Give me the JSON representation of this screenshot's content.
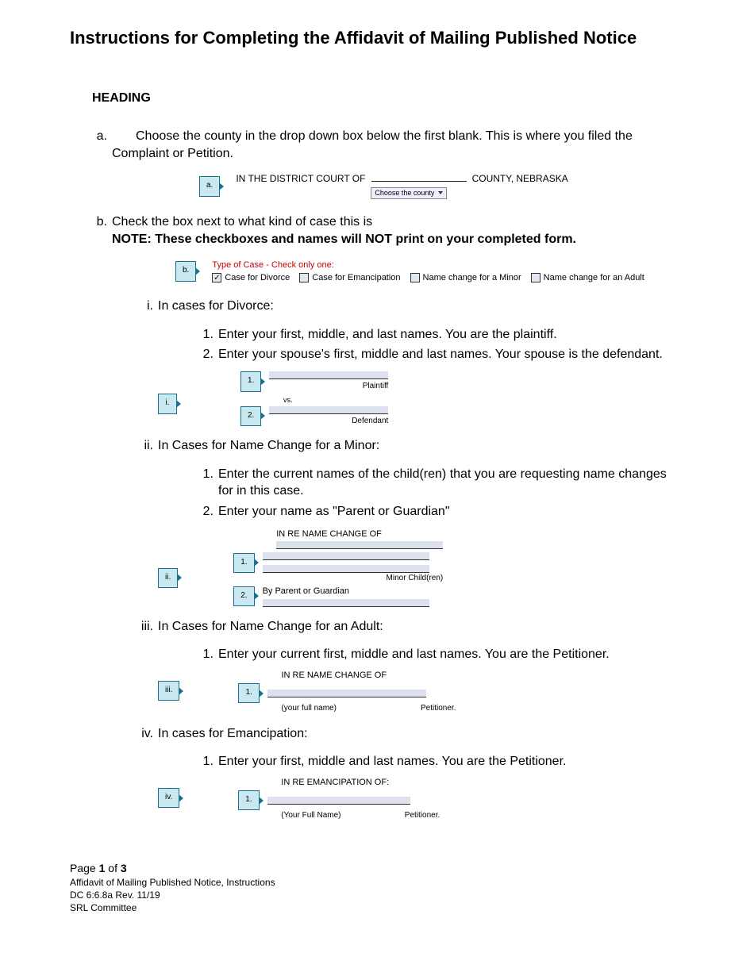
{
  "title": "Instructions for Completing the Affidavit of Mailing Published Notice",
  "sections": {
    "heading": "HEADING",
    "a": {
      "marker": "a.",
      "text": "Choose the county in the drop down box below the first blank. This is where you filed the Complaint or Petition.",
      "callout": "a.",
      "court_of": "IN THE  DISTRICT  COURT OF",
      "dropdown": "Choose the county",
      "county_ne": "COUNTY, NEBRASKA"
    },
    "b": {
      "marker": "b.",
      "text": "Check the box next to what kind of case this is",
      "note": "NOTE: These checkboxes and names will NOT print on your completed form.",
      "callout": "b.",
      "type_label": "Type of Case - Check only one:",
      "options": {
        "divorce": "Case for Divorce",
        "emancipation": "Case for Emancipation",
        "minor": "Name change for a Minor",
        "adult": "Name change for an Adult"
      }
    }
  },
  "roman": {
    "i": {
      "marker": "i.",
      "text": "In cases for Divorce:",
      "n1": {
        "marker": "1.",
        "text": "Enter your first, middle, and last names. You are the plaintiff."
      },
      "n2": {
        "marker": "2.",
        "text": "Enter your spouse's first, middle and last names. Your spouse is the defendant."
      },
      "callout_i": "i.",
      "callout_1": "1.",
      "callout_2": "2.",
      "plaintiff": "Plaintiff",
      "vs": "vs.",
      "defendant": "Defendant"
    },
    "ii": {
      "marker": "ii.",
      "text": "In Cases for Name Change for a Minor:",
      "n1": {
        "marker": "1.",
        "text": "Enter the current names of the child(ren) that you are requesting name changes for in this case."
      },
      "n2": {
        "marker": "2.",
        "text": "Enter your name as \"Parent or Guardian\""
      },
      "callout_ii": "ii.",
      "callout_1": "1.",
      "callout_2": "2.",
      "inre": "IN RE NAME CHANGE OF",
      "minor_children": "Minor Child(ren)",
      "by_parent": "By Parent or Guardian"
    },
    "iii": {
      "marker": "iii.",
      "text": "In Cases for Name Change for an Adult:",
      "n1": {
        "marker": "1.",
        "text": "Enter your current first, middle and last names. You are the Petitioner."
      },
      "callout_iii": "iii.",
      "callout_1": "1.",
      "inre": "IN RE NAME CHANGE OF",
      "fullname": "(your full name)",
      "petitioner": "Petitioner."
    },
    "iv": {
      "marker": "iv.",
      "text": "In cases for Emancipation:",
      "n1": {
        "marker": "1.",
        "text": "Enter your first, middle and last names. You are the Petitioner."
      },
      "callout_iv": "iv.",
      "callout_1": "1.",
      "inre": "IN RE EMANCIPATION OF:",
      "fullname": "(Your Full Name)",
      "petitioner": "Petitioner."
    }
  },
  "footer": {
    "page_prefix": "Page ",
    "page_num": "1",
    "page_of": " of ",
    "page_total": "3",
    "line2": "Affidavit of Mailing Published Notice, Instructions",
    "line3": "DC 6:6.8a Rev. 11/19",
    "line4": "SRL Committee"
  }
}
